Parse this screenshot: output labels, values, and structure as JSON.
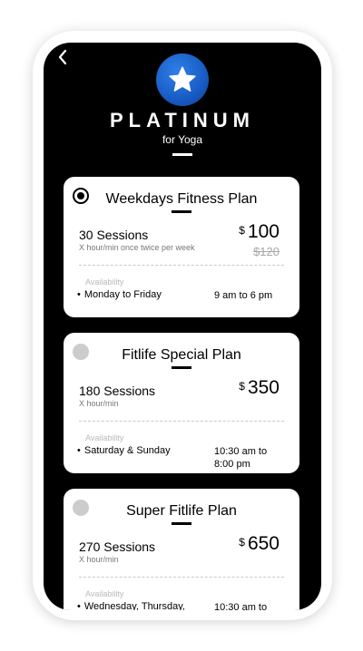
{
  "header": {
    "back_icon": "chevron-left-icon",
    "badge_icon": "star-icon",
    "title": "PLATINUM",
    "subtitle": "for Yoga"
  },
  "plans": [
    {
      "selected": true,
      "name": "Weekdays Fitness Plan",
      "sessions": "30 Sessions",
      "sessions_detail": "X hour/min once twice per week",
      "currency": "$",
      "price": "100",
      "old_price": "$120",
      "availability_label": "Availability",
      "days": "Monday to Friday",
      "hours": "9 am to 6 pm"
    },
    {
      "selected": false,
      "name": "Fitlife Special Plan",
      "sessions": "180 Sessions",
      "sessions_detail": "X hour/min",
      "currency": "$",
      "price": "350",
      "availability_label": "Availability",
      "days": "Saturday & Sunday",
      "hours": "10:30 am to 8:00 pm"
    },
    {
      "selected": false,
      "name": "Super Fitlife Plan",
      "sessions": "270 Sessions",
      "sessions_detail": "X hour/min",
      "currency": "$",
      "price": "650",
      "availability_label": "Availability",
      "days": "Wednesday, Thursday,",
      "hours": "10:30 am to"
    }
  ],
  "colors": {
    "screen_bg": "#000000",
    "card_bg": "#ffffff",
    "badge_blue": "#1a5fc7",
    "radio_inactive": "#cccccc"
  }
}
